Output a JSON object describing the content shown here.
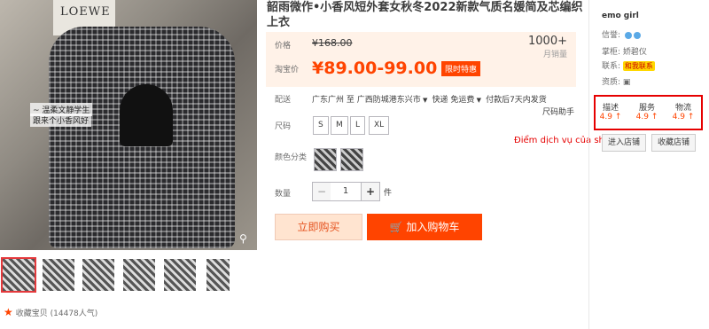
{
  "product": {
    "title": "韶雨微作•小香风短外套女秋冬2022新款气质名媛简及芯编织上衣",
    "price_label": "价格",
    "original_price": "¥168.00",
    "taobao_label": "淘宝价",
    "current_price": "¥89.00-99.00",
    "promo_badge": "限时特惠",
    "sales_count": "1000+",
    "sales_unit": "月销量",
    "shipping_label": "配送",
    "shipping_from": "广东广州 至",
    "shipping_to": "广西防城港东兴市",
    "courier": "快递 免运费",
    "delivery": "付款后7天内发货",
    "size_help": "尺码助手",
    "size_label": "尺码",
    "sizes": [
      "S",
      "M",
      "L",
      "XL"
    ],
    "color_label": "颜色分类",
    "qty_label": "数量",
    "qty_minus": "−",
    "qty_value": "1",
    "qty_plus": "+",
    "qty_unit": "件",
    "buy_now": "立即购买",
    "add_to_cart": "加入购物车"
  },
  "gallery": {
    "poster_text": "LOEWE",
    "caption_1": "~ 温柔文静学生",
    "caption_2": "跟来个小香风好",
    "favorite_text": "收藏宝贝 (14478人气)"
  },
  "shop": {
    "name": "emo girl",
    "credit_label": "信誉:",
    "manager_label": "掌柜:",
    "manager_name": "娇碧仪",
    "contact_label": "联系:",
    "contact_button": "和我联系",
    "qualification_label": "资质:",
    "score_desc_label": "描述",
    "score_desc_value": "4.9 ↑",
    "score_service_label": "服务",
    "score_service_value": "4.9 ↑",
    "score_logistics_label": "物流",
    "score_logistics_value": "4.9 ↑",
    "enter_shop": "进入店铺",
    "favorite_shop": "收藏店铺",
    "annotation": "Điểm dịch vụ của shop"
  },
  "colors": {
    "accent": "#ff4400",
    "annotation": "#e60000"
  }
}
